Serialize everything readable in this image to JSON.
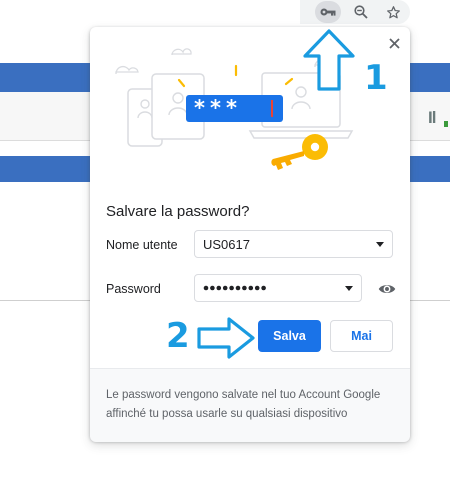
{
  "popup": {
    "title": "Salvare la password?",
    "badge_text": "***",
    "username_label": "Nome utente",
    "username_value": "US0617",
    "password_label": "Password",
    "password_dot_count": 10,
    "save_label": "Salva",
    "never_label": "Mai",
    "footer_text": "Le password vengono salvate nel tuo Account Google affinché tu possa usarle su qualsiasi dispositivo"
  },
  "background": {
    "side_text": "Il"
  },
  "annotations": {
    "step1": "1",
    "step2": "2"
  },
  "icons": {
    "toolbar": [
      "key-icon",
      "zoom-out-icon",
      "star-icon"
    ],
    "popup": [
      "close-icon",
      "eye-icon",
      "chevron-down-icon"
    ]
  },
  "colors": {
    "accent": "#1a73e8",
    "annotation": "#1a9be0",
    "page_band": "#3a6fc0",
    "key_gold": "#fbbc04"
  }
}
